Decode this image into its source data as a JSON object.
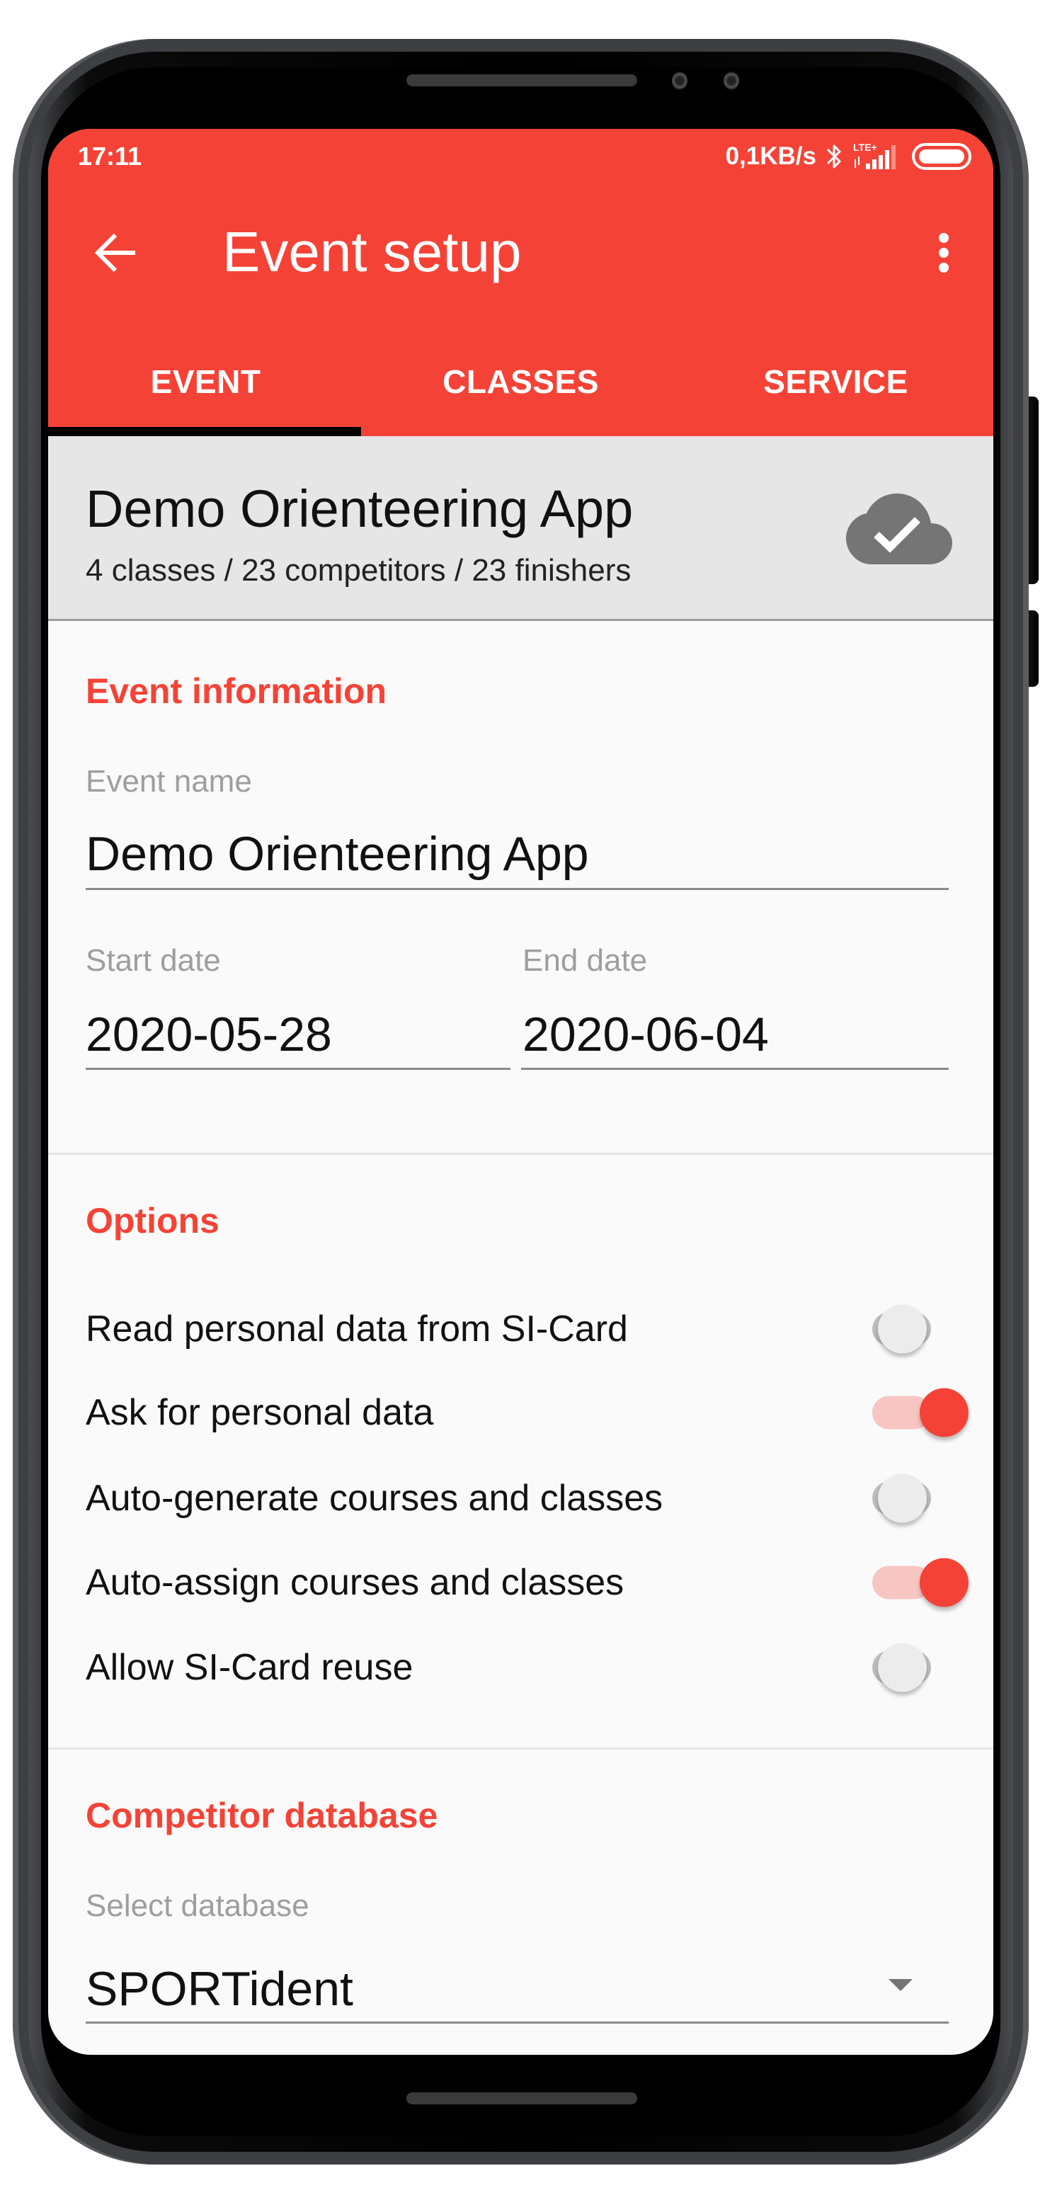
{
  "status_bar": {
    "time": "17:11",
    "network_speed": "0,1KB/s",
    "icons": [
      "bluetooth-icon",
      "lte-plus-signal-icon",
      "battery-icon"
    ],
    "network_type": "LTE+"
  },
  "app_bar": {
    "title": "Event setup",
    "back_icon": "arrow-left-icon",
    "menu_icon": "more-vert-icon",
    "background_color": "#f44336"
  },
  "tabs": [
    {
      "label": "EVENT",
      "selected": true
    },
    {
      "label": "CLASSES",
      "selected": false
    },
    {
      "label": "SERVICE",
      "selected": false
    }
  ],
  "event_card": {
    "title": "Demo Orienteering App",
    "summary": "4 classes / 23 competitors / 23 finishers",
    "sync_icon": "cloud-done-icon"
  },
  "event_information": {
    "header": "Event information",
    "event_name_label": "Event name",
    "event_name_value": "Demo Orienteering App",
    "start_date_label": "Start date",
    "start_date_value": "2020-05-28",
    "end_date_label": "End date",
    "end_date_value": "2020-06-04"
  },
  "options": {
    "header": "Options",
    "items": [
      {
        "label": "Read personal data from SI-Card",
        "enabled": false
      },
      {
        "label": "Ask for personal data",
        "enabled": true
      },
      {
        "label": "Auto-generate courses and classes",
        "enabled": false
      },
      {
        "label": "Auto-assign courses and classes",
        "enabled": true
      },
      {
        "label": "Allow SI-Card reuse",
        "enabled": false
      }
    ]
  },
  "competitor_database": {
    "header": "Competitor database",
    "select_label": "Select database",
    "selected_value": "SPORTident"
  },
  "colors": {
    "accent": "#f44336",
    "switch_on_track": "#f8c6c2",
    "switch_off_track": "#bdbdbd",
    "header_card_bg": "#e6e6e6"
  }
}
